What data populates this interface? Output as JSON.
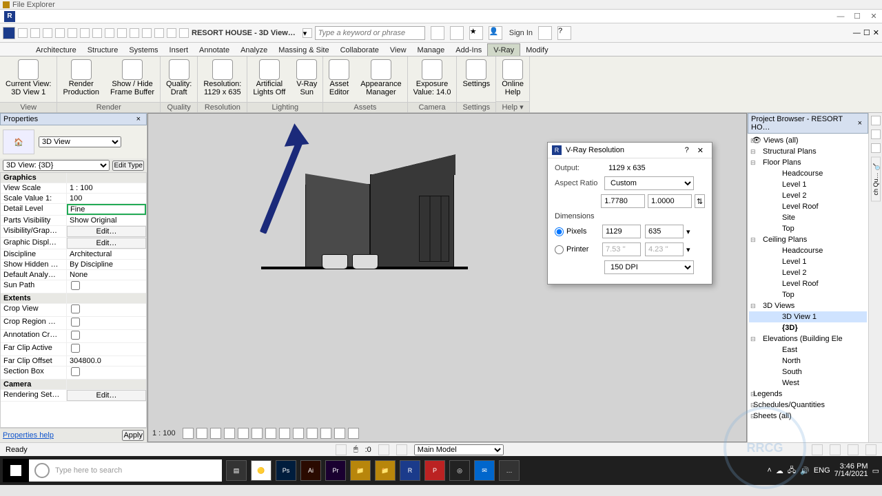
{
  "folderbar_label": "File Explorer",
  "doc_title": "RESORT HOUSE - 3D View…",
  "search_placeholder": "Type a keyword or phrase",
  "signin_label": "Sign In",
  "menu_tabs": [
    "Architecture",
    "Structure",
    "Systems",
    "Insert",
    "Annotate",
    "Analyze",
    "Massing & Site",
    "Collaborate",
    "View",
    "Manage",
    "Add-Ins",
    "V-Ray",
    "Modify"
  ],
  "active_tab": "V-Ray",
  "ribbon": {
    "groups": [
      {
        "label": "View",
        "tools": [
          {
            "l1": "Current View:",
            "l2": "3D View 1"
          }
        ]
      },
      {
        "label": "Render",
        "tools": [
          {
            "l1": "Render",
            "l2": "Production"
          },
          {
            "l1": "Show / Hide",
            "l2": "Frame Buffer"
          }
        ]
      },
      {
        "label": "Quality",
        "tools": [
          {
            "l1": "Quality:",
            "l2": "Draft"
          }
        ]
      },
      {
        "label": "Resolution",
        "tools": [
          {
            "l1": "Resolution:",
            "l2": "1129 x 635"
          }
        ]
      },
      {
        "label": "Lighting",
        "tools": [
          {
            "l1": "Artificial",
            "l2": "Lights Off"
          },
          {
            "l1": "V-Ray",
            "l2": "Sun"
          }
        ]
      },
      {
        "label": "Assets",
        "tools": [
          {
            "l1": "Asset",
            "l2": "Editor"
          },
          {
            "l1": "Appearance",
            "l2": "Manager"
          }
        ]
      },
      {
        "label": "Camera",
        "tools": [
          {
            "l1": "Exposure",
            "l2": "Value: 14.0"
          }
        ]
      },
      {
        "label": "Settings",
        "tools": [
          {
            "l1": "Settings",
            "l2": ""
          }
        ]
      },
      {
        "label": "Help ▾",
        "tools": [
          {
            "l1": "Online",
            "l2": "Help"
          }
        ]
      }
    ]
  },
  "properties": {
    "title": "Properties",
    "type_label": "3D View",
    "view_selector": "3D View: {3D}",
    "edit_type": "Edit Type",
    "help": "Properties help",
    "apply": "Apply",
    "sections": [
      {
        "name": "Graphics",
        "rows": [
          {
            "k": "View Scale",
            "v": "1 : 100"
          },
          {
            "k": "Scale Value  1:",
            "v": "100"
          },
          {
            "k": "Detail Level",
            "v": "Fine",
            "hl": true
          },
          {
            "k": "Parts Visibility",
            "v": "Show Original"
          },
          {
            "k": "Visibility/Grap…",
            "v": "Edit…",
            "btn": true
          },
          {
            "k": "Graphic Displ…",
            "v": "Edit…",
            "btn": true
          },
          {
            "k": "Discipline",
            "v": "Architectural"
          },
          {
            "k": "Show Hidden …",
            "v": "By Discipline"
          },
          {
            "k": "Default Analy…",
            "v": "None"
          },
          {
            "k": "Sun Path",
            "chk": false
          }
        ]
      },
      {
        "name": "Extents",
        "rows": [
          {
            "k": "Crop View",
            "chk": false
          },
          {
            "k": "Crop Region …",
            "chk": false
          },
          {
            "k": "Annotation Cr…",
            "chk": false
          },
          {
            "k": "Far Clip Active",
            "chk": false
          },
          {
            "k": "Far Clip Offset",
            "v": "304800.0"
          },
          {
            "k": "Section Box",
            "chk": false
          }
        ]
      },
      {
        "name": "Camera",
        "rows": [
          {
            "k": "Rendering Set…",
            "v": "Edit…",
            "btn": true
          }
        ]
      }
    ]
  },
  "viewport": {
    "scale": "1 : 100"
  },
  "vray_dialog": {
    "title": "V-Ray Resolution",
    "output_label": "Output:",
    "output_value": "1129 x 635",
    "aspect_label": "Aspect Ratio",
    "aspect_value": "Custom",
    "aspect_a": "1.7780",
    "aspect_b": "1.0000",
    "dim_label": "Dimensions",
    "pixels_label": "Pixels",
    "pixels_w": "1129",
    "pixels_h": "635",
    "printer_label": "Printer",
    "printer_w": "7.53 ''",
    "printer_h": "4.23 ''",
    "dpi": "150 DPI"
  },
  "project_browser": {
    "title": "Project Browser - RESORT HO…",
    "views_root": "Views (all)",
    "nodes": [
      {
        "t": "Structural Plans",
        "lvl": 1
      },
      {
        "t": "Floor Plans",
        "lvl": 1
      },
      {
        "t": "Headcourse",
        "lvl": 2,
        "leaf": true
      },
      {
        "t": "Level 1",
        "lvl": 2,
        "leaf": true
      },
      {
        "t": "Level 2",
        "lvl": 2,
        "leaf": true
      },
      {
        "t": "Level Roof",
        "lvl": 2,
        "leaf": true
      },
      {
        "t": "Site",
        "lvl": 2,
        "leaf": true
      },
      {
        "t": "Top",
        "lvl": 2,
        "leaf": true
      },
      {
        "t": "Ceiling Plans",
        "lvl": 1
      },
      {
        "t": "Headcourse",
        "lvl": 2,
        "leaf": true
      },
      {
        "t": "Level 1",
        "lvl": 2,
        "leaf": true
      },
      {
        "t": "Level 2",
        "lvl": 2,
        "leaf": true
      },
      {
        "t": "Level Roof",
        "lvl": 2,
        "leaf": true
      },
      {
        "t": "Top",
        "lvl": 2,
        "leaf": true
      },
      {
        "t": "3D Views",
        "lvl": 1
      },
      {
        "t": "3D View 1",
        "lvl": 2,
        "leaf": true,
        "sel": true
      },
      {
        "t": "{3D}",
        "lvl": 2,
        "leaf": true,
        "bold": true
      },
      {
        "t": "Elevations (Building Ele",
        "lvl": 1
      },
      {
        "t": "East",
        "lvl": 2,
        "leaf": true
      },
      {
        "t": "North",
        "lvl": 2,
        "leaf": true
      },
      {
        "t": "South",
        "lvl": 2,
        "leaf": true
      },
      {
        "t": "West",
        "lvl": 2,
        "leaf": true
      },
      {
        "t": "Legends",
        "lvl": 0
      },
      {
        "t": "Schedules/Quantities",
        "lvl": 0
      },
      {
        "t": "Sheets (all)",
        "lvl": 0
      }
    ]
  },
  "statusbar": {
    "ready": "Ready",
    "main_model": "Main Model",
    "zero": ":0"
  },
  "taskbar": {
    "search_placeholder": "Type here to search",
    "lang": "ENG",
    "time": "3:46 PM",
    "date": "7/14/2021"
  },
  "watermark": "RRCG"
}
